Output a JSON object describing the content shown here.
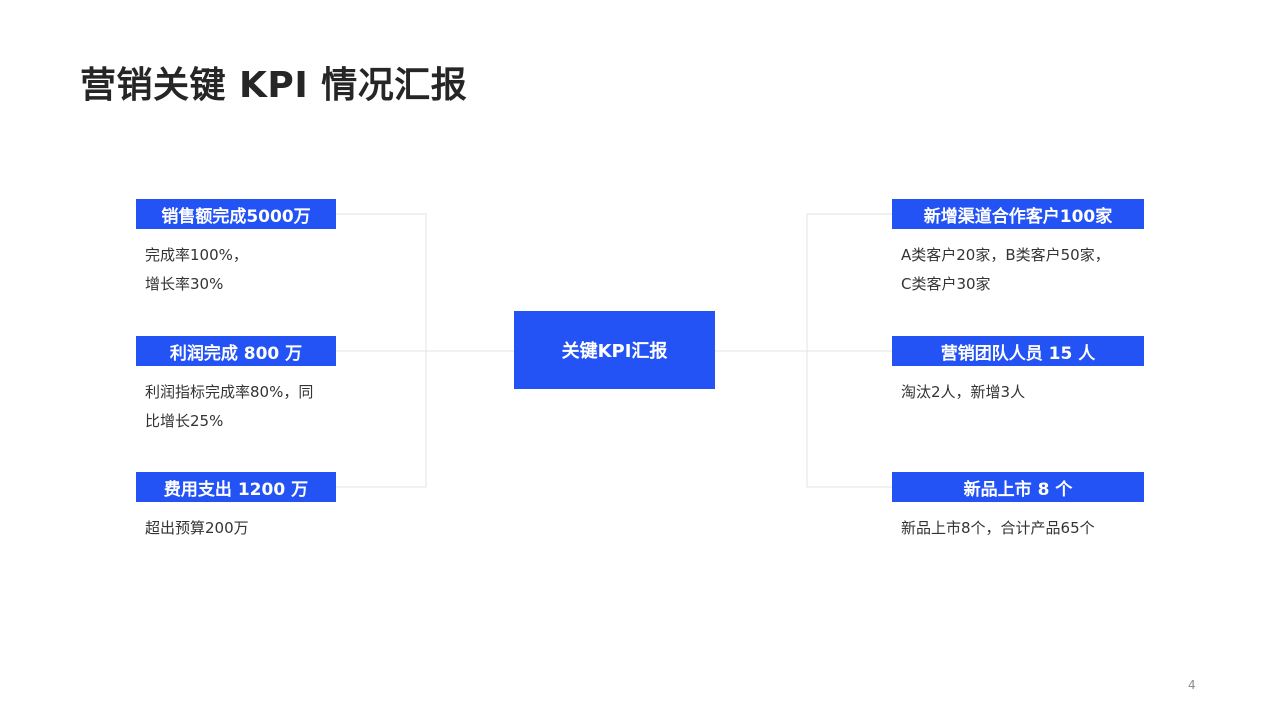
{
  "title": "营销关键 KPI 情况汇报",
  "center": {
    "label": "关键KPI汇报"
  },
  "left_items": [
    {
      "label": "销售额完成5000万",
      "desc": [
        "完成率100%，",
        "增长率30%"
      ]
    },
    {
      "label": "利润完成 800 万",
      "desc": [
        "利润指标完成率80%，同",
        "比增长25%"
      ]
    },
    {
      "label": "费用支出 1200 万",
      "desc": [
        "超出预算200万"
      ]
    }
  ],
  "right_items": [
    {
      "label": "新增渠道合作客户100家",
      "desc": [
        "A类客户20家，B类客户50家，",
        "C类客户30家"
      ]
    },
    {
      "label": "营销团队人员 15 人",
      "desc": [
        "淘汰2人，新增3人"
      ]
    },
    {
      "label": "新品上市 8 个",
      "desc": [
        "新品上市8个，合计产品65个"
      ]
    }
  ],
  "page_number": "4",
  "colors": {
    "accent": "#2352f5",
    "connector": "#e3e3e3"
  }
}
